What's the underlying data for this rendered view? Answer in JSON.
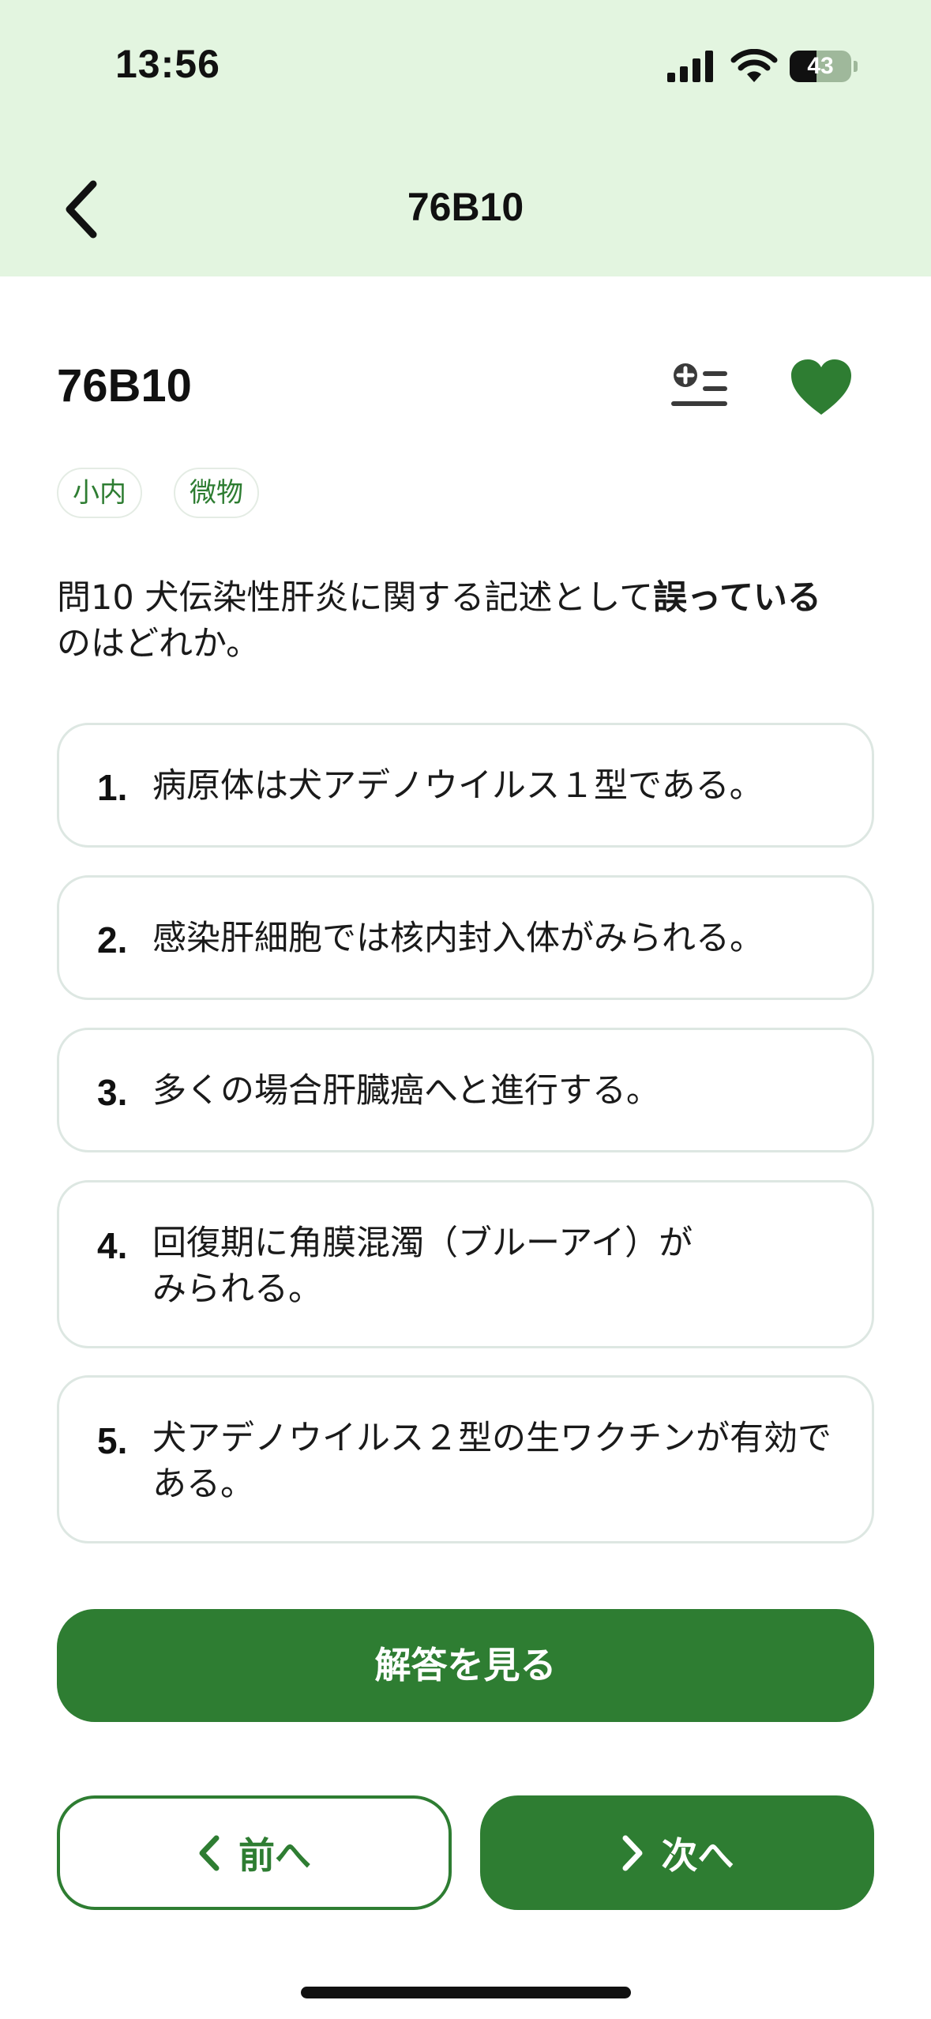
{
  "status_bar": {
    "time": "13:56",
    "battery_level": "43",
    "battery_fraction": 0.43
  },
  "nav": {
    "title": "76B10",
    "back_icon": "chevron-left-icon"
  },
  "question": {
    "id": "76B10",
    "tags": [
      "小内",
      "微物"
    ],
    "text_before": "問10 犬伝染性肝炎に関する記述として",
    "text_bold": "誤っている",
    "text_after": "のはどれか。",
    "add_to_list_icon": "add-to-list-icon",
    "favorite_icon": "heart-icon",
    "favorite_color": "#2e7d32"
  },
  "choices": [
    {
      "num": "1.",
      "text": "病原体は犬アデノウイルス１型である。"
    },
    {
      "num": "2.",
      "text": "感染肝細胞では核内封入体がみられる。"
    },
    {
      "num": "3.",
      "text": "多くの場合肝臓癌へと進行する。"
    },
    {
      "num": "4.",
      "text": "回復期に角膜混濁（ブルーアイ）が\nみられる。"
    },
    {
      "num": "5.",
      "text": "犬アデノウイルス２型の生ワクチンが有効である。"
    }
  ],
  "actions": {
    "show_answer": "解答を見る",
    "prev": "前へ",
    "next": "次へ"
  },
  "colors": {
    "header_bg": "#e3f5e0",
    "accent": "#2e7d32",
    "border": "#dde7e2"
  }
}
